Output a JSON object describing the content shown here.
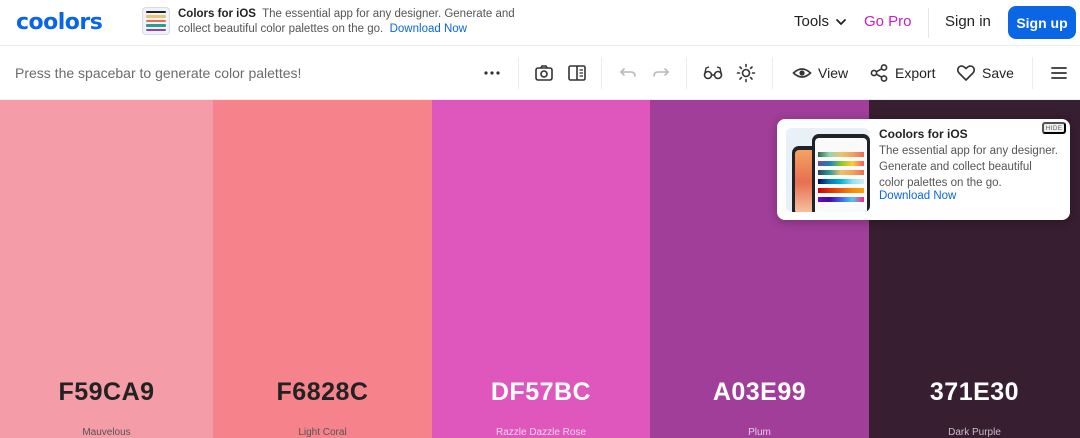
{
  "header": {
    "logo": "coolors",
    "promo": {
      "title": "Colors for iOS",
      "desc": "The essential app for any designer. Generate and collect beautiful color palettes on the go.",
      "link": "Download Now"
    },
    "tools_label": "Tools",
    "gopro_label": "Go Pro",
    "signin_label": "Sign in",
    "signup_label": "Sign up"
  },
  "toolbar": {
    "hint": "Press the spacebar to generate color palettes!",
    "view_label": "View",
    "export_label": "Export",
    "save_label": "Save",
    "icons": [
      "more-icon",
      "camera-icon",
      "sidebar-icon",
      "undo-icon",
      "redo-icon",
      "glasses-icon",
      "sun-icon",
      "eye-icon",
      "share-icon",
      "heart-icon",
      "menu-icon"
    ]
  },
  "palette": [
    {
      "hex": "F59CA9",
      "name": "Mauvelous",
      "color": "#F59CA9",
      "text": "#222222",
      "subtext": "#555555"
    },
    {
      "hex": "F6828C",
      "name": "Light Coral",
      "color": "#F6828C",
      "text": "#222222",
      "subtext": "#555555"
    },
    {
      "hex": "DF57BC",
      "name": "Razzle Dazzle Rose",
      "color": "#DF57BC",
      "text": "#FFFFFF",
      "subtext": "#F3D4EC"
    },
    {
      "hex": "A03E99",
      "name": "Plum",
      "color": "#A03E99",
      "text": "#FFFFFF",
      "subtext": "#E4CDE2"
    },
    {
      "hex": "371E30",
      "name": "Dark Purple",
      "color": "#371E30",
      "text": "#FFFFFF",
      "subtext": "#C9BFC6"
    }
  ],
  "popup": {
    "title": "Coolors for iOS",
    "desc": "The essential app for any designer. Generate and collect beautiful color palettes on the go.",
    "link": "Download Now",
    "hide_label": "HIDE"
  },
  "colors": {
    "brand": "#0A66E4",
    "gopro": "#C81EC3"
  }
}
